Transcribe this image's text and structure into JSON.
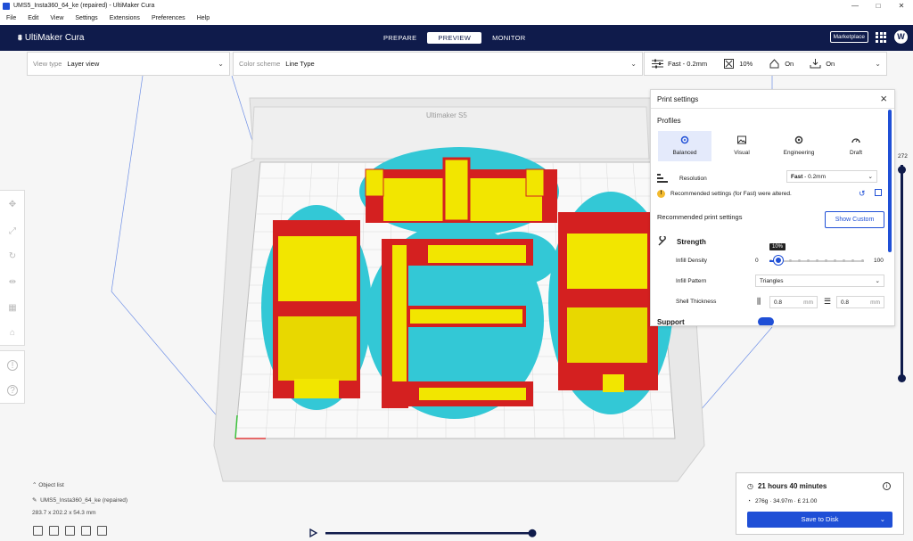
{
  "window": {
    "title": "UMS5_Insta360_64_ke (repaired) - UltiMaker Cura",
    "controls": [
      "—",
      "□",
      "✕"
    ]
  },
  "menu": [
    "File",
    "Edit",
    "View",
    "Settings",
    "Extensions",
    "Preferences",
    "Help"
  ],
  "header": {
    "logo": "UltiMaker Cura",
    "stages": [
      "PREPARE",
      "PREVIEW",
      "MONITOR"
    ],
    "active_stage": "PREVIEW",
    "marketplace": "Marketplace",
    "avatar": "W"
  },
  "viewbar": {
    "view_type_label": "View type",
    "view_type_value": "Layer view",
    "color_scheme_label": "Color scheme",
    "color_scheme_value": "Line Type"
  },
  "settings_bar": {
    "profile": "Fast - 0.2mm",
    "infill": "10%",
    "support": "On",
    "adhesion": "On"
  },
  "print_settings": {
    "title": "Print settings",
    "profiles_label": "Profiles",
    "profiles": [
      "Balanced",
      "Visual",
      "Engineering",
      "Draft"
    ],
    "active_profile": "Balanced",
    "resolution_label": "Resolution",
    "resolution_value_bold": "Fast",
    "resolution_value": " - 0.2mm",
    "warning": "Recommended settings (for Fast) were altered.",
    "recommended_label": "Recommended print settings",
    "show_custom": "Show Custom",
    "strength_label": "Strength",
    "infill_density_label": "Infill Density",
    "infill_min": "0",
    "infill_max": "100",
    "infill_value": 0.1,
    "infill_tooltip": "10%",
    "infill_pattern_label": "Infill Pattern",
    "infill_pattern_value": "Triangles",
    "shell_label": "Shell Thickness",
    "shell_wall": "0.8",
    "shell_top": "0.8",
    "unit": "mm",
    "support_label": "Support"
  },
  "build_plate": {
    "brand": "Ultimaker S5"
  },
  "layer_slider": {
    "value": "272"
  },
  "object": {
    "list_label": "Object list",
    "name": "UMS5_Insta360_64_ke (repaired)",
    "dims": "283.7 x 202.2 x 54.3 mm"
  },
  "print_info": {
    "time": "21 hours 40 minutes",
    "material": "276g · 34.97m · £ 21.00",
    "save": "Save to Disk"
  },
  "colors": {
    "accent": "#1f4fd6",
    "header": "#0f1b4b",
    "wall": "#d42020",
    "infill": "#f2e600",
    "support": "#33c8d6"
  }
}
